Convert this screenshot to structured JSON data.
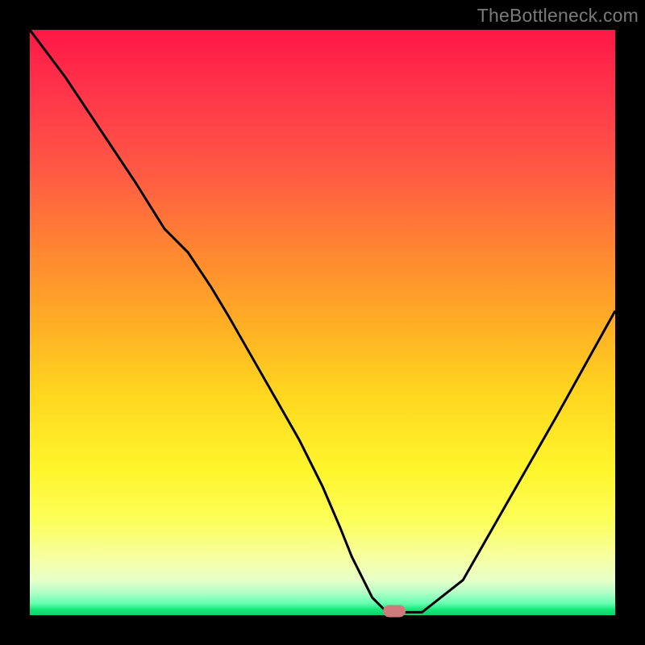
{
  "watermark": "TheBottleneck.com",
  "colors": {
    "frame_bg": "#000000",
    "curve": "#000000",
    "marker": "#cf7b7b",
    "gradient_top": "#ff1846",
    "gradient_bottom": "#0fd36a"
  },
  "chart_data": {
    "type": "line",
    "title": "",
    "xlabel": "",
    "ylabel": "",
    "xlim": [
      0,
      100
    ],
    "ylim": [
      0,
      100
    ],
    "x": [
      0,
      6,
      12,
      18,
      23,
      27,
      31,
      34,
      38,
      42,
      46,
      50,
      53,
      55,
      57,
      58.5,
      60.5,
      63.5,
      67,
      74,
      82,
      90,
      100
    ],
    "values": [
      100,
      92,
      83,
      74,
      66,
      62,
      56,
      51,
      44,
      37,
      30,
      22,
      15,
      10,
      6,
      3,
      1,
      0.5,
      0.5,
      6,
      20,
      34,
      52
    ],
    "marker": {
      "x": 62.2,
      "y": 0.7
    },
    "annotations": []
  }
}
